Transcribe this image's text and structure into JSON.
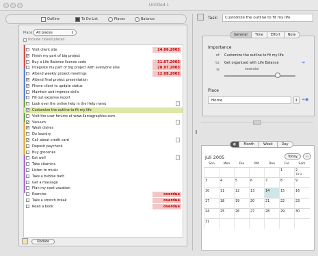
{
  "window": {
    "title": "Untitled 1"
  },
  "toolbar": {
    "segments": [
      {
        "label": "Outline"
      },
      {
        "label": "To Do List"
      },
      {
        "label": "Places"
      },
      {
        "label": "Balance"
      }
    ]
  },
  "filters": {
    "place_label": "Place",
    "place_value": "All places",
    "include_closed_label": "Include closed places"
  },
  "tasks": [
    {
      "text": "Visit client site",
      "checked": false,
      "date": "24.06.2003"
    },
    {
      "text": "Finish my part of big project",
      "checked": true,
      "date": ""
    },
    {
      "text": "Buy a Life Balance license code",
      "checked": false,
      "date": "31.07.2003"
    },
    {
      "text": "Integrate my part of big project with everyone else",
      "checked": false,
      "date": "28.07.2003"
    },
    {
      "text": "Attend weekly project meetings",
      "checked": false,
      "date": "12.08.2003"
    },
    {
      "text": "Attend final project presentation",
      "checked": true,
      "date": ""
    },
    {
      "text": "Phone client to update status",
      "checked": true,
      "date": ""
    },
    {
      "text": "Maintain and improve skills",
      "checked": false,
      "date": ""
    },
    {
      "text": "Fill out expense report",
      "checked": false,
      "date": ""
    },
    {
      "text": "Look over the online help in the Help menu",
      "checked": false,
      "date": ""
    },
    {
      "text": "Customize the outline to fit my life",
      "checked": true,
      "date": "",
      "highlight": true
    },
    {
      "text": "Visit the user forums at www.llamagraphics.com",
      "checked": false,
      "date": ""
    },
    {
      "text": "Vacuum",
      "checked": true,
      "date": ""
    },
    {
      "text": "Wash dishes",
      "checked": true,
      "date": ""
    },
    {
      "text": "Do laundry",
      "checked": false,
      "date": ""
    },
    {
      "text": "Call about credit card",
      "checked": true,
      "date": ""
    },
    {
      "text": "Deposit paycheck",
      "checked": false,
      "date": ""
    },
    {
      "text": "Buy groceries",
      "checked": false,
      "date": ""
    },
    {
      "text": "Eat well",
      "checked": false,
      "date": ""
    },
    {
      "text": "Take vitamins",
      "checked": false,
      "date": ""
    },
    {
      "text": "Listen to music",
      "checked": false,
      "date": ""
    },
    {
      "text": "Take a bubble bath",
      "checked": false,
      "date": ""
    },
    {
      "text": "Get a massage",
      "checked": false,
      "date": ""
    },
    {
      "text": "Plan my next vacation",
      "checked": false,
      "date": ""
    },
    {
      "text": "Exercise",
      "checked": false,
      "date": "overdue"
    },
    {
      "text": "Take a stretch break",
      "checked": false,
      "date": "overdue"
    },
    {
      "text": "Read a book",
      "checked": false,
      "date": "overdue"
    }
  ],
  "footer": {
    "update_label": "Update"
  },
  "task_panel": {
    "task_label": "Task:",
    "task_value": "Customize the outline to fit my life",
    "tabs": [
      "General",
      "Time",
      "Effort",
      "Note"
    ],
    "importance_title": "Importance",
    "of_label": "of:",
    "of_value": "Customize the outline to fit my life",
    "to_label": "to:",
    "to_value": "Get organized with Life Balance",
    "is_label": "is:",
    "is_value": "essential",
    "importance_level": 0.75,
    "place_title": "Place",
    "place_value": "Home"
  },
  "calendar": {
    "month_title": "Juli 2005",
    "views": [
      "Month",
      "Week",
      "Day"
    ],
    "today_label": "Today",
    "weekdays": [
      "Son",
      "Mon",
      "Die",
      "Mit",
      "Don",
      "Fre",
      "Sam"
    ],
    "weeks": [
      [
        "",
        "",
        "",
        "",
        "",
        "1",
        "2"
      ],
      [
        "3",
        "4",
        "5",
        "6",
        "7",
        "8",
        "9"
      ],
      [
        "10",
        "11",
        "12",
        "13",
        "14",
        "15",
        "16"
      ],
      [
        "17",
        "18",
        "19",
        "20",
        "21",
        "22",
        "23"
      ],
      [
        "24",
        "25",
        "26",
        "27",
        "28",
        "29",
        "30"
      ],
      [
        "31",
        "",
        "",
        "",
        "",
        "",
        ""
      ]
    ],
    "event_cell_text": "19 H...",
    "today_day": "14"
  }
}
